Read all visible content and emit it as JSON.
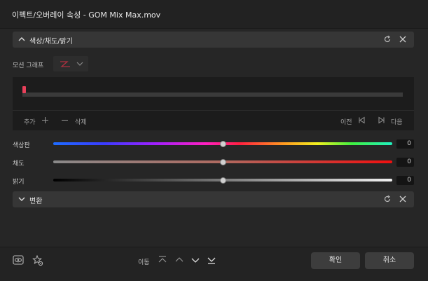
{
  "window": {
    "title": "이펙트/오버레이 속성 - GOM Mix Max.mov"
  },
  "section_color": {
    "label": "색상/채도/밝기"
  },
  "motion_graph": {
    "label": "모션 그래프",
    "selected_icon": "zigzag-red-icon"
  },
  "keyframes": {
    "add_label": "추가",
    "delete_label": "삭제",
    "prev_label": "이전",
    "next_label": "다음"
  },
  "sliders": [
    {
      "label": "색상판",
      "value": "0"
    },
    {
      "label": "채도",
      "value": "0"
    },
    {
      "label": "밝기",
      "value": "0"
    }
  ],
  "section_transform": {
    "label": "변환"
  },
  "footer": {
    "move_label": "이동",
    "ok_label": "확인",
    "cancel_label": "취소"
  },
  "colors": {
    "keyframe_marker": "#e8405a",
    "panel_bg": "#262626"
  }
}
